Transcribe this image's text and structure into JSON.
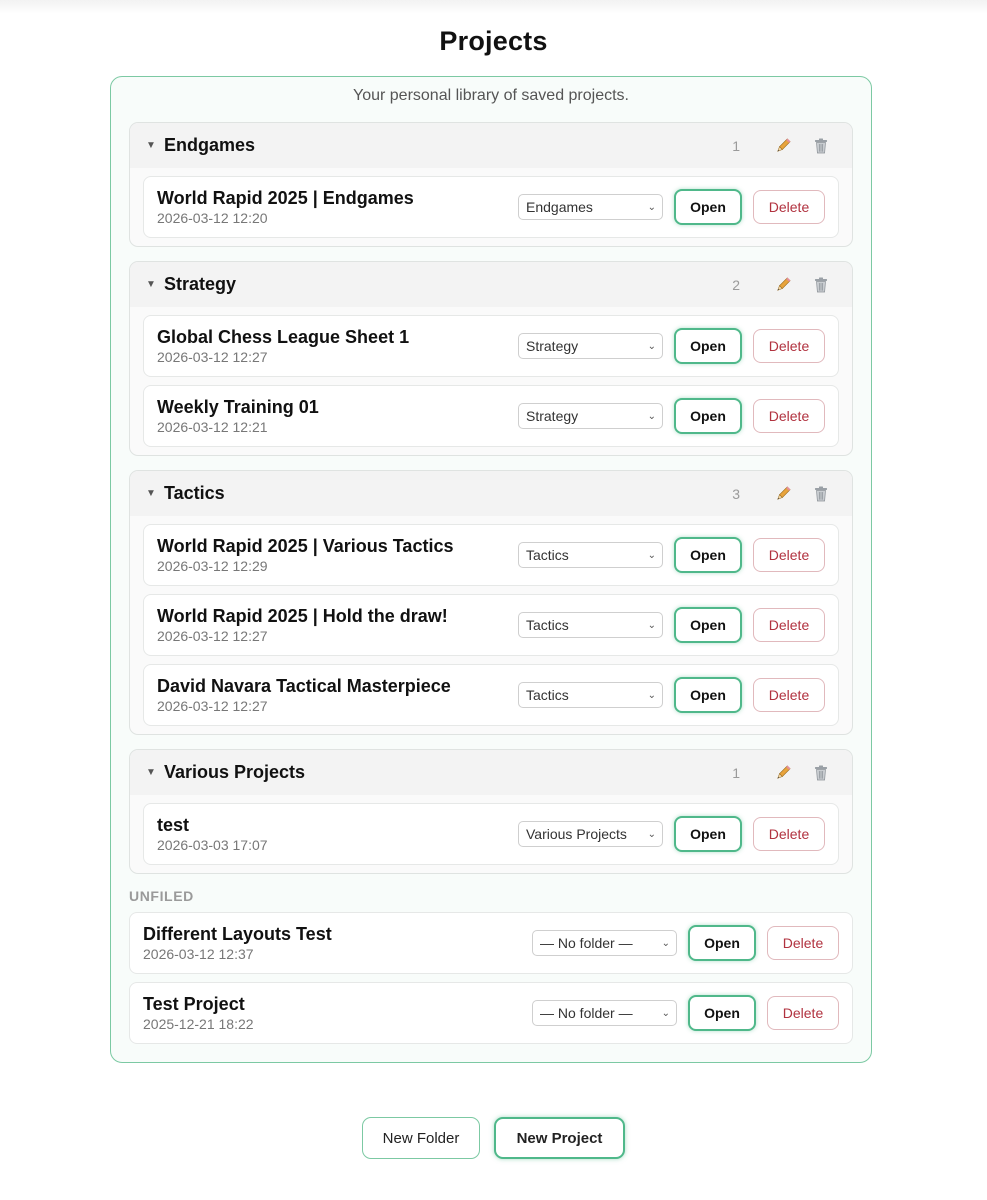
{
  "page": {
    "title": "Projects",
    "subtitle": "Your personal library of saved projects."
  },
  "labels": {
    "open": "Open",
    "delete": "Delete",
    "unfiled": "UNFILED",
    "caret": "▼",
    "chevron": "⌄"
  },
  "icons": {
    "edit": "pencil-icon",
    "trash": "trash-icon"
  },
  "colors": {
    "accent": "#4fb88a",
    "delete_text": "#b1323f"
  },
  "folders": [
    {
      "name": "Endgames",
      "count": "1",
      "projects": [
        {
          "title": "World Rapid 2025 | Endgames",
          "date": "2026-03-12 12:20",
          "folder_select": "Endgames"
        }
      ]
    },
    {
      "name": "Strategy",
      "count": "2",
      "projects": [
        {
          "title": "Global Chess League Sheet 1",
          "date": "2026-03-12 12:27",
          "folder_select": "Strategy"
        },
        {
          "title": "Weekly Training 01",
          "date": "2026-03-12 12:21",
          "folder_select": "Strategy"
        }
      ]
    },
    {
      "name": "Tactics",
      "count": "3",
      "projects": [
        {
          "title": "World Rapid 2025 | Various Tactics",
          "date": "2026-03-12 12:29",
          "folder_select": "Tactics"
        },
        {
          "title": "World Rapid 2025 | Hold the draw!",
          "date": "2026-03-12 12:27",
          "folder_select": "Tactics"
        },
        {
          "title": "David Navara Tactical Masterpiece",
          "date": "2026-03-12 12:27",
          "folder_select": "Tactics"
        }
      ]
    },
    {
      "name": "Various Projects",
      "count": "1",
      "projects": [
        {
          "title": "test",
          "date": "2026-03-03 17:07",
          "folder_select": "Various Projects"
        }
      ]
    }
  ],
  "unfiled": [
    {
      "title": "Different Layouts Test",
      "date": "2026-03-12 12:37",
      "folder_select": "— No folder —"
    },
    {
      "title": "Test Project",
      "date": "2025-12-21 18:22",
      "folder_select": "— No folder —"
    }
  ],
  "actions": {
    "new_folder": "New Folder",
    "new_project": "New Project"
  }
}
